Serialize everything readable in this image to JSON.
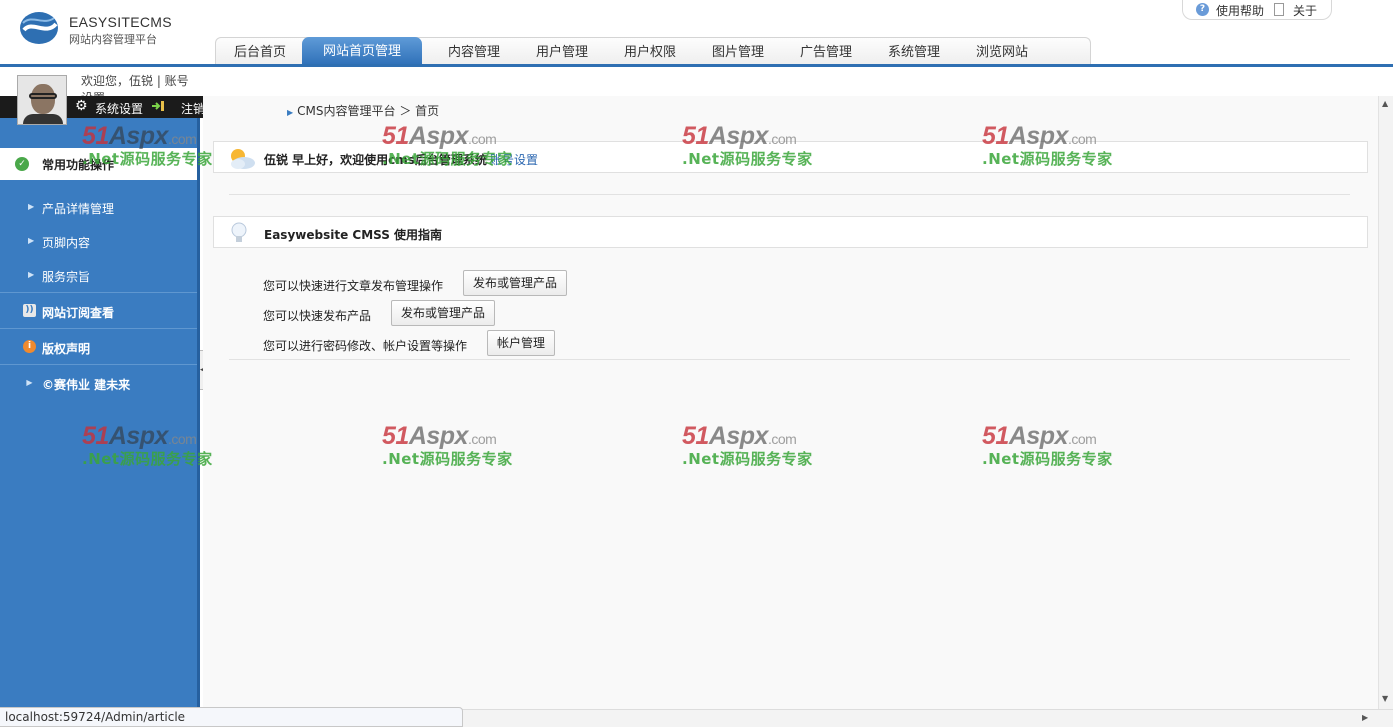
{
  "logo": {
    "name": "EASYSITECMS",
    "subtitle": "网站内容管理平台"
  },
  "top_links": {
    "help": "使用帮助",
    "about": "关于"
  },
  "nav": {
    "tabs": [
      {
        "label": "后台首页"
      },
      {
        "label": "网站首页管理",
        "active": true
      },
      {
        "label": "内容管理"
      },
      {
        "label": "用户管理"
      },
      {
        "label": "用户权限"
      },
      {
        "label": "图片管理"
      },
      {
        "label": "广告管理"
      },
      {
        "label": "系统管理"
      },
      {
        "label": "浏览网站"
      }
    ]
  },
  "user": {
    "welcome": "欢迎您，伍锐 | 账号设置"
  },
  "actions": {
    "settings": "系统设置",
    "logout": "注销",
    "exit": "退出"
  },
  "sidebar": {
    "header": "常用功能操作",
    "items": [
      {
        "label": "产品详情管理"
      },
      {
        "label": "页脚内容"
      },
      {
        "label": "服务宗旨"
      }
    ],
    "sections": [
      {
        "label": "网站订阅查看",
        "icon": "rss-icon"
      },
      {
        "label": "版权声明",
        "icon": "info-icon"
      },
      {
        "label": "©赛伟业 建未来",
        "icon": "arrow-icon"
      }
    ]
  },
  "breadcrumb": "CMS内容管理平台 ＞ 首页",
  "greeting": {
    "text": "伍锐 早上好，欢迎使用cms后台管理系统",
    "link": "账号设置"
  },
  "guide": {
    "title": "Easywebsite CMSS 使用指南",
    "rows": [
      {
        "text": "您可以快速进行文章发布管理操作",
        "button": "发布或管理产品"
      },
      {
        "text": "您可以快速发布产品",
        "button": "发布或管理产品"
      },
      {
        "text": "您可以进行密码修改、帐户设置等操作",
        "button": "帐户管理"
      }
    ]
  },
  "status_url": "localhost:59724/Admin/article",
  "watermark": {
    "brand_a": "51",
    "brand_b": "Aspx",
    "brand_c": ".com",
    "slogan": ".Net源码服务专家"
  },
  "colors": {
    "accent": "#3a7cc1",
    "nav_active": "#2d6fb7",
    "dark_bar": "#1b1b1b"
  }
}
